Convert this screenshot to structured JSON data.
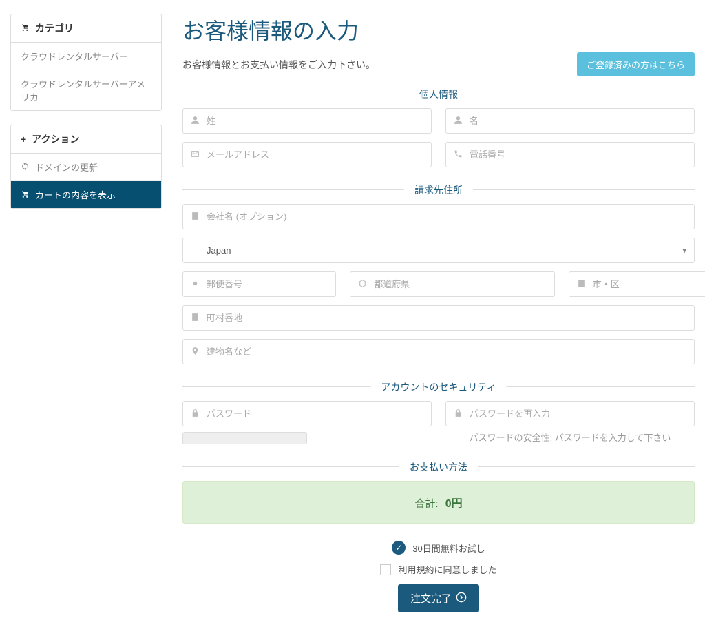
{
  "sidebar": {
    "categories": {
      "title": "カテゴリ",
      "items": [
        "クラウドレンタルサーバー",
        "クラウドレンタルサーバーアメリカ"
      ]
    },
    "actions": {
      "title": "アクション",
      "items": [
        "ドメインの更新",
        "カートの内容を表示"
      ]
    }
  },
  "page": {
    "title": "お客様情報の入力",
    "subtitle": "お客様情報とお支払い情報をご入力下さい。",
    "login_button": "ご登録済みの方はこちら"
  },
  "sections": {
    "personal": "個人情報",
    "billing": "請求先住所",
    "security": "アカウントのセキュリティ",
    "payment": "お支払い方法"
  },
  "placeholders": {
    "lastname": "姓",
    "firstname": "名",
    "email": "メールアドレス",
    "phone": "電話番号",
    "company": "会社名 (オプション)",
    "postcode": "郵便番号",
    "state": "都道府県",
    "city": "市・区",
    "address1": "町村番地",
    "address2": "建物名など",
    "password": "パスワード",
    "password2": "パスワードを再入力"
  },
  "country": {
    "selected": "Japan"
  },
  "password_strength": {
    "label": "パスワードの安全性: ",
    "status": "パスワードを入力して下さい"
  },
  "summary": {
    "total_label": "合計:",
    "total_value": "0円"
  },
  "options": {
    "trial": "30日間無料お試し",
    "tos": "利用規約に同意しました"
  },
  "submit": "注文完了"
}
